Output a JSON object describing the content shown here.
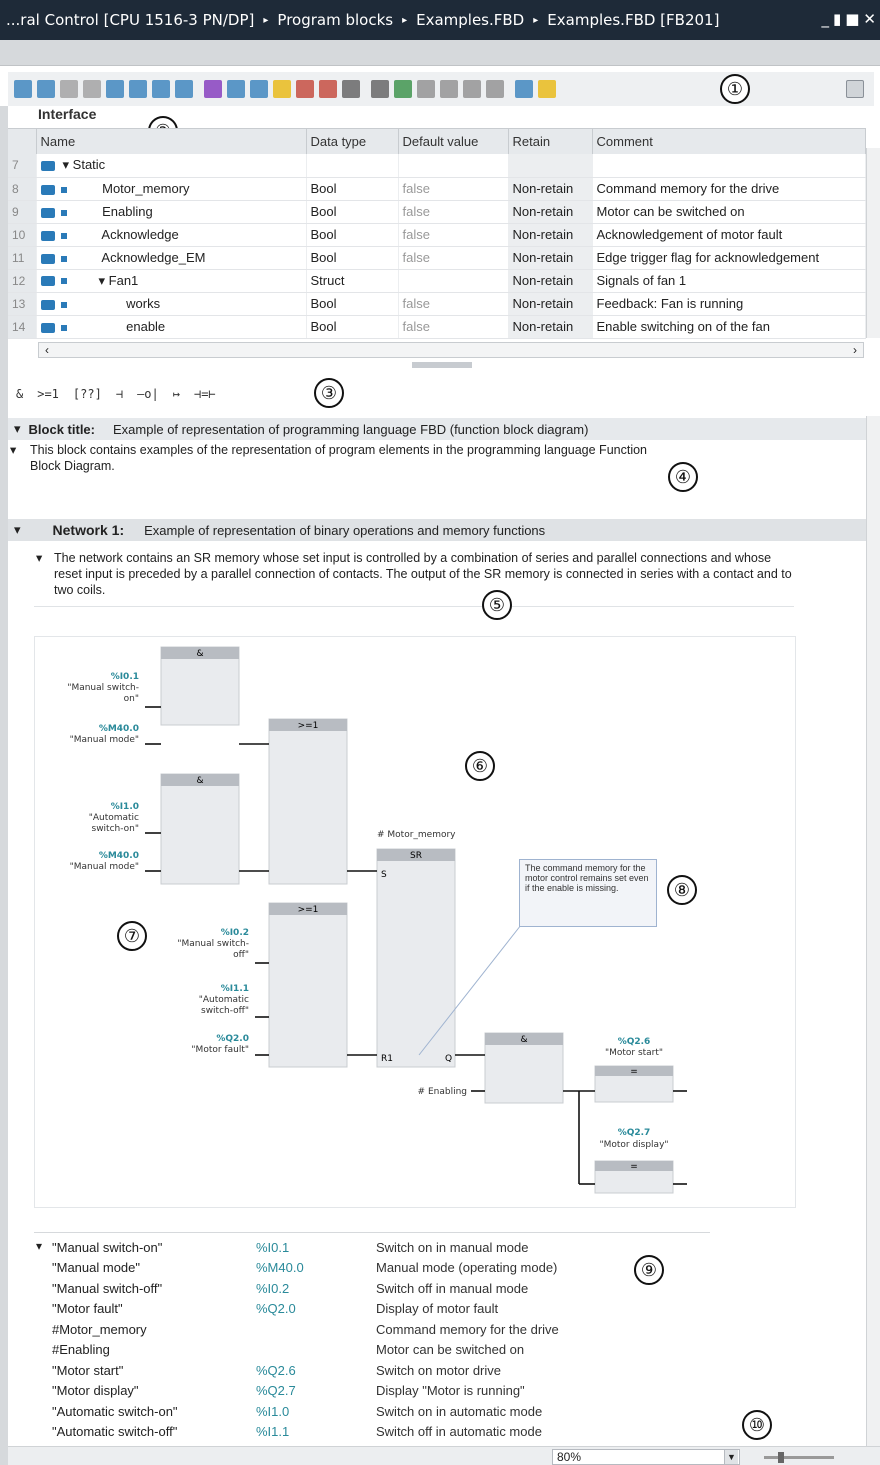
{
  "titlebar": {
    "crumbs": [
      "...ral Control [CPU 1516-3 PN/DP]",
      "Program blocks",
      "Examples.FBD",
      "Examples.FBD [FB201]"
    ],
    "separator": "▸",
    "winbtns": [
      "_",
      "▮",
      "■",
      "✕"
    ]
  },
  "callouts": [
    "①",
    "②",
    "③",
    "④",
    "⑤",
    "⑥",
    "⑦",
    "⑧",
    "⑨",
    "⑩"
  ],
  "toolbar": {
    "icon_colors": [
      "#2a7ab8",
      "#2a7ab8",
      "#999",
      "#999",
      "#2a7ab8",
      "#2a7ab8",
      "#2a7ab8",
      "#2a7ab8",
      "#7a2ab8",
      "#2a7ab8",
      "#2a7ab8",
      "#e8b400",
      "#c0392b",
      "#c0392b",
      "#555",
      "#555",
      "#2a8a3a",
      "#888",
      "#888",
      "#888",
      "#888",
      "#2a7ab8",
      "#e8b400"
    ]
  },
  "interface": {
    "label": "Interface",
    "columns": [
      "Name",
      "Data type",
      "Default value",
      "Retain",
      "Comment"
    ],
    "rows": [
      {
        "num": "7",
        "name": "Static",
        "type": "",
        "default": "",
        "retain": "",
        "comment": "",
        "expander": "▾",
        "indent": 0
      },
      {
        "num": "8",
        "name": "Motor_memory",
        "type": "Bool",
        "default": "false",
        "retain": "Non-retain",
        "comment": "Command memory for the drive",
        "expander": "",
        "indent": 1
      },
      {
        "num": "9",
        "name": "Enabling",
        "type": "Bool",
        "default": "false",
        "retain": "Non-retain",
        "comment": "Motor can be switched on",
        "expander": "",
        "indent": 1
      },
      {
        "num": "10",
        "name": "Acknowledge",
        "type": "Bool",
        "default": "false",
        "retain": "Non-retain",
        "comment": "Acknowledgement of motor fault",
        "expander": "",
        "indent": 1
      },
      {
        "num": "11",
        "name": "Acknowledge_EM",
        "type": "Bool",
        "default": "false",
        "retain": "Non-retain",
        "comment": "Edge trigger flag for acknowledgement",
        "expander": "",
        "indent": 1
      },
      {
        "num": "12",
        "name": "Fan1",
        "type": "Struct",
        "default": "",
        "retain": "Non-retain",
        "comment": "Signals of fan 1",
        "expander": "▾",
        "indent": 1
      },
      {
        "num": "13",
        "name": "works",
        "type": "Bool",
        "default": "false",
        "retain": "Non-retain",
        "comment": "Feedback: Fan is running",
        "expander": "",
        "indent": 2
      },
      {
        "num": "14",
        "name": "enable",
        "type": "Bool",
        "default": "false",
        "retain": "Non-retain",
        "comment": "Enable switching on of the fan",
        "expander": "",
        "indent": 2
      }
    ],
    "scroll_left": "‹",
    "scroll_right": "›"
  },
  "fbd_toolbar": [
    "&",
    ">=1",
    "[??]",
    "⊣",
    "—o|",
    "↦",
    "⊣=⊢"
  ],
  "block": {
    "title_label": "Block title:",
    "title_text": "Example of representation of programming language FBD (function block diagram)",
    "comment": "This block contains examples of the representation of program elements in the programming language Function Block Diagram."
  },
  "network": {
    "label": "Network 1:",
    "title": "Example of representation of binary operations and memory functions",
    "comment": "The network contains an SR memory whose set input is controlled by a combination of series and parallel connections and whose reset input is preceded by a parallel connection of contacts. The output of the SR memory is connected in series with a contact and to two coils."
  },
  "diagram": {
    "and_label": "&",
    "or_label": ">=1",
    "sr_label": "SR",
    "assign_label": "=",
    "sr_instance": "# Motor_memory",
    "sr_pins": {
      "s": "S",
      "r1": "R1",
      "q": "Q"
    },
    "enabling": "# Enabling",
    "inputs_and1": [
      {
        "addr": "%I0.1",
        "tag1": "\"Manual switch-",
        "tag2": "on\""
      },
      {
        "addr": "%M40.0",
        "tag1": "\"Manual mode\"",
        "tag2": ""
      }
    ],
    "inputs_and2": [
      {
        "addr": "%I1.0",
        "tag1": "\"Automatic",
        "tag2": "switch-on\""
      },
      {
        "addr": "%M40.0",
        "tag1": "\"Manual mode\"",
        "tag2": ""
      }
    ],
    "inputs_or2": [
      {
        "addr": "%I0.2",
        "tag1": "\"Manual switch-",
        "tag2": "off\""
      },
      {
        "addr": "%I1.1",
        "tag1": "\"Automatic",
        "tag2": "switch-off\""
      },
      {
        "addr": "%Q2.0",
        "tag1": "\"Motor fault\"",
        "tag2": ""
      }
    ],
    "outputs": [
      {
        "addr": "%Q2.6",
        "tag": "\"Motor start\""
      },
      {
        "addr": "%Q2.7",
        "tag": "\"Motor display\""
      }
    ],
    "comment_box": "The command memory for the motor control remains set even if the enable is missing."
  },
  "symbols": [
    {
      "name": "\"Manual switch-on\"",
      "addr": "%I0.1",
      "comment": "Switch on in manual mode"
    },
    {
      "name": "\"Manual mode\"",
      "addr": "%M40.0",
      "comment": "Manual mode (operating mode)"
    },
    {
      "name": "\"Manual switch-off\"",
      "addr": "%I0.2",
      "comment": "Switch off in manual mode"
    },
    {
      "name": "\"Motor fault\"",
      "addr": "%Q2.0",
      "comment": "Display of motor fault"
    },
    {
      "name": "#Motor_memory",
      "addr": "",
      "comment": "Command memory for the drive"
    },
    {
      "name": "#Enabling",
      "addr": "",
      "comment": "Motor can be switched on"
    },
    {
      "name": "\"Motor start\"",
      "addr": "%Q2.6",
      "comment": "Switch on motor drive"
    },
    {
      "name": "\"Motor display\"",
      "addr": "%Q2.7",
      "comment": "Display \"Motor is running\""
    },
    {
      "name": "\"Automatic switch-on\"",
      "addr": "%I1.0",
      "comment": "Switch on in automatic mode"
    },
    {
      "name": "\"Automatic switch-off\"",
      "addr": "%I1.1",
      "comment": "Switch off in automatic mode"
    }
  ],
  "status": {
    "zoom": "80%"
  }
}
